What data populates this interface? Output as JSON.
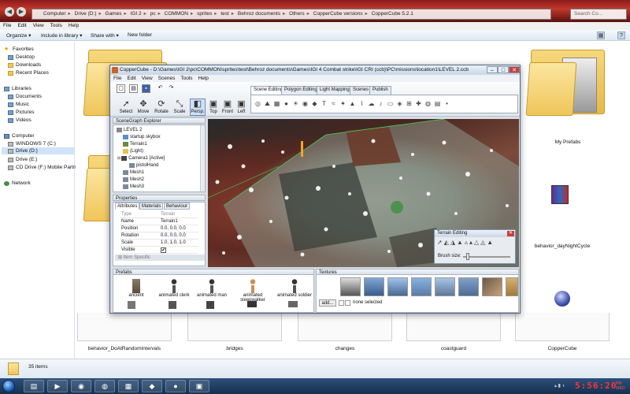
{
  "explorer": {
    "breadcrumb": [
      "Computer",
      "Drive (D:)",
      "Games",
      "IGI 2",
      "pc",
      "COMMON",
      "sprites",
      "test",
      "Behroz documents",
      "Others",
      "CopperCube versions",
      "CopperCube 5.2.1"
    ],
    "search_placeholder": "Search Co...",
    "menu": [
      "File",
      "Edit",
      "View",
      "Tools",
      "Help"
    ],
    "toolbar": {
      "organize": "Organize ▾",
      "include": "Include in library ▾",
      "share": "Share with ▾",
      "new_folder": "New folder"
    },
    "nav": {
      "favorites": "Favorites",
      "desktop": "Desktop",
      "downloads": "Downloads",
      "recent": "Recent Places",
      "libraries": "Libraries",
      "documents": "Documents",
      "music": "Music",
      "pictures": "Pictures",
      "videos": "Videos",
      "computer": "Computer",
      "windows7": "WINDOWS 7 (C:)",
      "drive_d": "Drive (D:)",
      "drive_e": "Drive (E:)",
      "cd_drive": "CD Drive (F:) Mobile Partn",
      "network": "Network"
    },
    "items": {
      "my_prefabs": "My Prefabs",
      "daynight": "behavior_dayNightCycle",
      "doatrandom": "behavior_DoAtRandomIntervals",
      "bridges": "bridges",
      "changes": "changes",
      "coastguard": "coastguard",
      "coppercube": "CopperCube"
    },
    "status_count": "35 items"
  },
  "taskbar": {
    "clock": "5:56:20",
    "clock_ampm": "PM",
    "clock_day": "WED"
  },
  "coppercube": {
    "title": "CopperCube - D:\\Games\\IGI 2\\pc\\COMMON\\sprites\\test\\Behroz documents\\Games\\IGI 4 Combat strike\\IGI CRI (ccb)\\PC\\missions\\location1\\LEVEL 2.ccb",
    "menu": [
      "File",
      "Edit",
      "View",
      "Scenes",
      "Tools",
      "Help"
    ],
    "tools": {
      "select": "Select",
      "move": "Move",
      "rotate": "Rotate",
      "scale": "Scale",
      "persp": "Persp.",
      "top": "Top",
      "front": "Front",
      "left": "Left"
    },
    "tabs": [
      "Scene Editing",
      "Polygon Editing",
      "Light Mapping",
      "Scenes",
      "Publish"
    ],
    "scenegraph": {
      "header": "SceneGraph Explorer",
      "nodes": [
        "LEVEL 2",
        "startup skybox",
        "Terrain1",
        "(Light)",
        "Camera1 [Active]",
        "pistolHand",
        "Mesh1",
        "Mesh2",
        "Mesh3"
      ]
    },
    "properties": {
      "header": "Properties",
      "tabs": [
        "Attributes",
        "Materials",
        "Behaviour"
      ],
      "rows": [
        {
          "k": "Type",
          "v": "Terrain"
        },
        {
          "k": "Name",
          "v": "Terrain1"
        },
        {
          "k": "Position",
          "v": "0.0, 0.0, 0.0"
        },
        {
          "k": "Rotation",
          "v": "0.0, 0.0, 0.0"
        },
        {
          "k": "Scale",
          "v": "1.0, 1.0, 1.0"
        },
        {
          "k": "Visible",
          "v": "✔"
        },
        {
          "k": "Item Specific",
          "v": ""
        }
      ]
    },
    "terrain_editor": {
      "title": "Terrain Editing",
      "brush_label": "Brush size:"
    },
    "prefabs": {
      "header": "Prefabs",
      "items": [
        "ancient",
        "animated clerk",
        "animated man",
        "animated sleepwalker",
        "animated soldier"
      ]
    },
    "textures": {
      "header": "Textures",
      "add": "add...",
      "none_selected": "none selected"
    }
  }
}
